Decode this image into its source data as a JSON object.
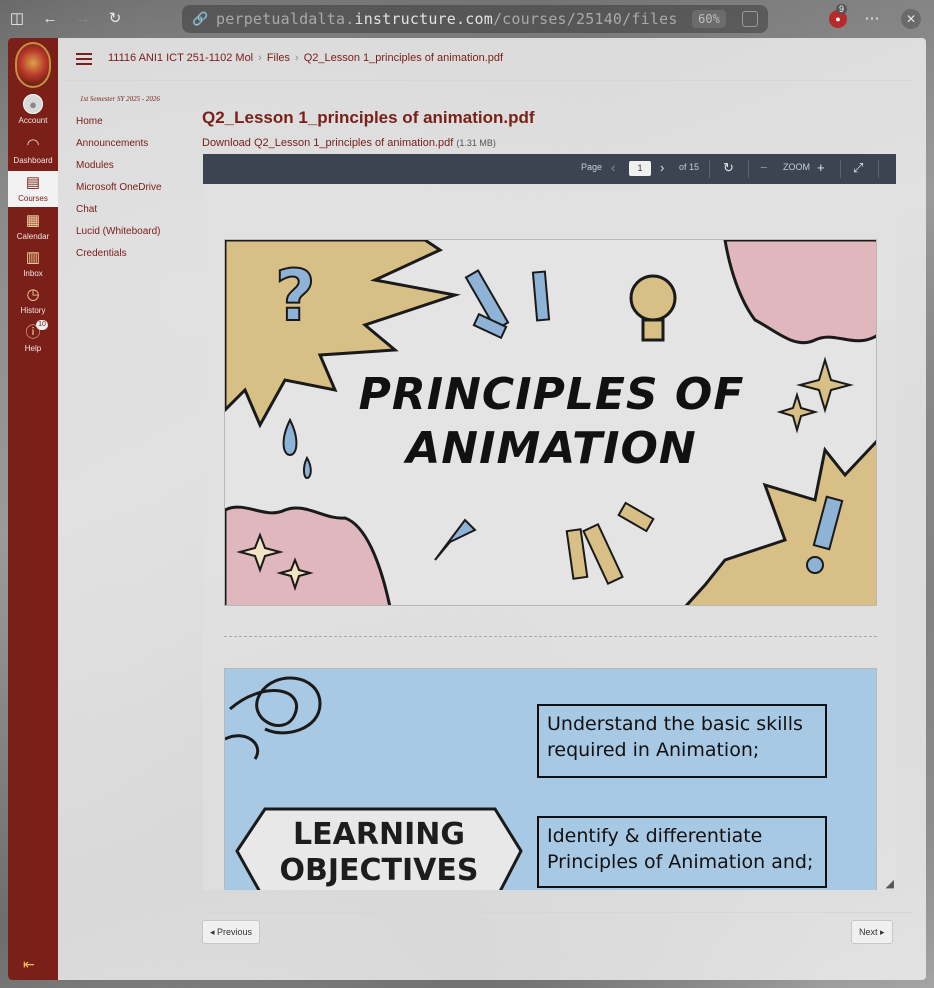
{
  "browser": {
    "url_host": "perpetualdalta.",
    "url_domain": "instructure.com",
    "url_path": "/courses/25140/files",
    "zoom": "60%",
    "extension_count": "9"
  },
  "global_nav": {
    "items": [
      {
        "label": "Account",
        "icon": "user-avatar-icon"
      },
      {
        "label": "Dashboard",
        "icon": "dashboard-icon"
      },
      {
        "label": "Courses",
        "icon": "courses-book-icon"
      },
      {
        "label": "Calendar",
        "icon": "calendar-icon"
      },
      {
        "label": "Inbox",
        "icon": "inbox-icon"
      },
      {
        "label": "History",
        "icon": "clock-icon"
      },
      {
        "label": "Help",
        "icon": "help-icon"
      }
    ],
    "help_badge": "10"
  },
  "breadcrumb": {
    "course": "11116 ANI1 ICT 251-1102 Mol",
    "section": "Files",
    "file": "Q2_Lesson 1_principles of animation.pdf"
  },
  "course_nav": {
    "term": "1st Semester SY 2025 - 2026",
    "items": [
      "Home",
      "Announcements",
      "Modules",
      "Microsoft OneDrive",
      "Chat",
      "Lucid (Whiteboard)",
      "Credentials"
    ]
  },
  "file": {
    "title": "Q2_Lesson 1_principles of animation.pdf",
    "download_label": "Download Q2_Lesson 1_principles of animation.pdf",
    "size": "(1.31 MB)"
  },
  "pdf_toolbar": {
    "page_label": "Page",
    "page_value": "1",
    "of_label": "of 15",
    "zoom_label": "ZOOM"
  },
  "slides": {
    "slide1_title_line1": "PRINCIPLES OF",
    "slide1_title_line2": "ANIMATION",
    "slide2_heading_line1": "LEARNING",
    "slide2_heading_line2": "OBJECTIVES",
    "objective1_line1": "Understand the basic skills",
    "objective1_line2": "required in Animation;",
    "objective2_line1": "Identify & differentiate",
    "objective2_line2": "Principles of Animation and;"
  },
  "pager": {
    "previous": "◂ Previous",
    "next": "Next ▸"
  }
}
